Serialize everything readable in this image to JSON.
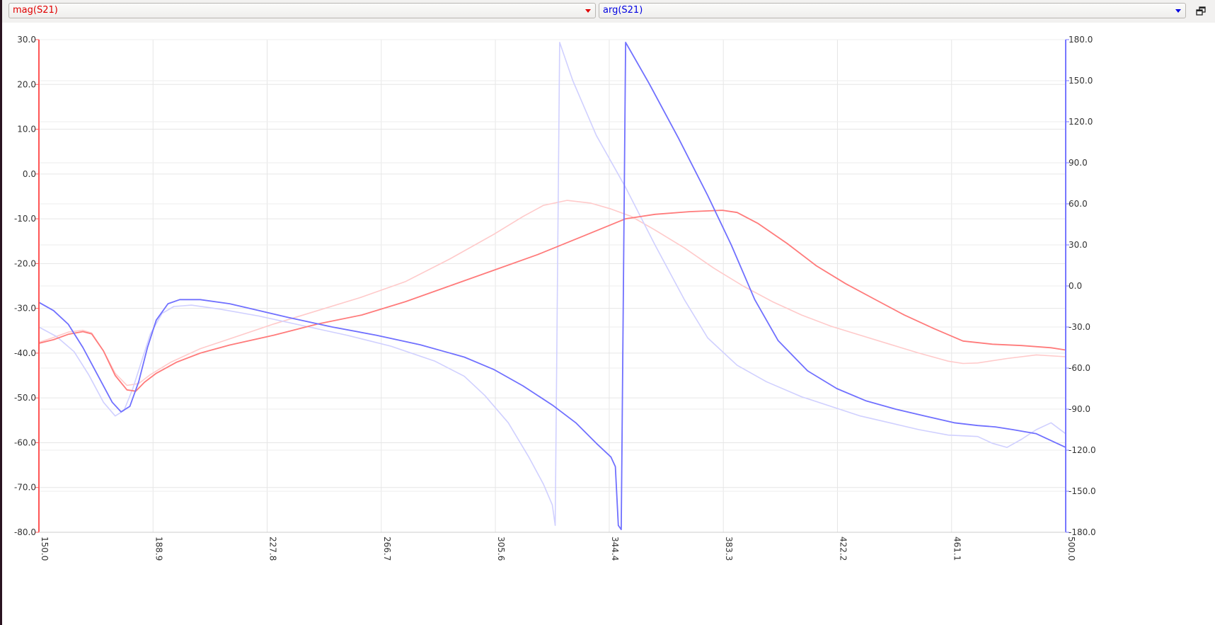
{
  "toolbar": {
    "left_select": {
      "value": "mag(S21)",
      "color": "#e00000"
    },
    "right_select": {
      "value": "arg(S21)",
      "color": "#0000e0"
    },
    "restore_icon": "window-restore-icon"
  },
  "colors": {
    "mag_axis": "#ff5555",
    "arg_axis": "#7777ff",
    "mag_current": "#ff7b7b",
    "mag_previous": "#ffcaca",
    "arg_current": "#7070ff",
    "arg_previous": "#d0d0ff",
    "grid": "#e6e6e6"
  },
  "chart_data": {
    "type": "line",
    "x_axis": {
      "ticks": [
        "150.0",
        "188.9",
        "227.8",
        "266.7",
        "305.6",
        "344.4",
        "383.3",
        "422.2",
        "461.1",
        "500.0"
      ],
      "range": [
        150.0,
        500.0
      ],
      "label_orientation": "vertical"
    },
    "y_left": {
      "ticks": [
        "30.0",
        "20.0",
        "10.0",
        "0.0",
        "-10.0",
        "-20.0",
        "-30.0",
        "-40.0",
        "-50.0",
        "-60.0",
        "-70.0",
        "-80.0"
      ],
      "range": [
        -80,
        30
      ]
    },
    "y_right": {
      "ticks": [
        "180.0",
        "150.0",
        "120.0",
        "90.0",
        "60.0",
        "30.0",
        "0.0",
        "-30.0",
        "-60.0",
        "-90.0",
        "-120.0",
        "-150.0",
        "-180.0"
      ],
      "range": [
        -180,
        180
      ]
    },
    "grid": true,
    "series": [
      {
        "axis": "left",
        "style": "previous",
        "color": "#ffcaca",
        "points": [
          [
            150,
            -37.6
          ],
          [
            155,
            -36.5
          ],
          [
            160,
            -35.3
          ],
          [
            165,
            -34.9
          ],
          [
            168,
            -35.5
          ],
          [
            172,
            -39.5
          ],
          [
            176,
            -44.5
          ],
          [
            180,
            -47.2
          ],
          [
            184,
            -46.8
          ],
          [
            188,
            -44.8
          ],
          [
            195,
            -42
          ],
          [
            205,
            -39
          ],
          [
            215,
            -36.8
          ],
          [
            230,
            -33.5
          ],
          [
            245,
            -30.5
          ],
          [
            260,
            -27.5
          ],
          [
            275,
            -24
          ],
          [
            290,
            -19
          ],
          [
            305,
            -13.5
          ],
          [
            315,
            -9.5
          ],
          [
            322,
            -7
          ],
          [
            330,
            -5.9
          ],
          [
            338,
            -6.5
          ],
          [
            345,
            -7.8
          ],
          [
            352,
            -9.5
          ],
          [
            360,
            -12.5
          ],
          [
            370,
            -16.5
          ],
          [
            380,
            -21
          ],
          [
            390,
            -25
          ],
          [
            400,
            -28.5
          ],
          [
            410,
            -31.5
          ],
          [
            420,
            -34
          ],
          [
            430,
            -36
          ],
          [
            440,
            -38
          ],
          [
            450,
            -40
          ],
          [
            460,
            -41.8
          ],
          [
            465,
            -42.3
          ],
          [
            470,
            -42.2
          ],
          [
            480,
            -41.2
          ],
          [
            490,
            -40.4
          ],
          [
            500,
            -40.8
          ]
        ]
      },
      {
        "axis": "left",
        "style": "current",
        "color": "#ff7b7b",
        "points": [
          [
            150,
            -37.8
          ],
          [
            155,
            -37
          ],
          [
            160,
            -35.8
          ],
          [
            165,
            -35.2
          ],
          [
            168,
            -35.7
          ],
          [
            172,
            -39.5
          ],
          [
            176,
            -45
          ],
          [
            180,
            -48.2
          ],
          [
            183,
            -48.5
          ],
          [
            186,
            -46.5
          ],
          [
            190,
            -44.5
          ],
          [
            197,
            -42
          ],
          [
            205,
            -40
          ],
          [
            215,
            -38.2
          ],
          [
            230,
            -36
          ],
          [
            245,
            -33.5
          ],
          [
            260,
            -31.5
          ],
          [
            275,
            -28.5
          ],
          [
            290,
            -25
          ],
          [
            305,
            -21.5
          ],
          [
            320,
            -18
          ],
          [
            335,
            -14
          ],
          [
            350,
            -10
          ],
          [
            360,
            -9
          ],
          [
            372,
            -8.4
          ],
          [
            383,
            -8.1
          ],
          [
            388,
            -8.6
          ],
          [
            395,
            -11
          ],
          [
            405,
            -15.5
          ],
          [
            415,
            -20.5
          ],
          [
            425,
            -24.5
          ],
          [
            435,
            -28
          ],
          [
            445,
            -31.5
          ],
          [
            455,
            -34.5
          ],
          [
            465,
            -37.3
          ],
          [
            475,
            -38
          ],
          [
            485,
            -38.3
          ],
          [
            495,
            -38.8
          ],
          [
            500,
            -39.3
          ]
        ]
      },
      {
        "axis": "right",
        "style": "previous",
        "color": "#d0d0ff",
        "points": [
          [
            150,
            -30
          ],
          [
            156,
            -37
          ],
          [
            162,
            -48
          ],
          [
            167,
            -65
          ],
          [
            172,
            -85
          ],
          [
            176,
            -95
          ],
          [
            179,
            -91
          ],
          [
            182,
            -75
          ],
          [
            185,
            -55
          ],
          [
            188,
            -35
          ],
          [
            192,
            -20
          ],
          [
            196,
            -15
          ],
          [
            202,
            -14
          ],
          [
            212,
            -17
          ],
          [
            225,
            -22
          ],
          [
            240,
            -29
          ],
          [
            255,
            -36
          ],
          [
            270,
            -44
          ],
          [
            285,
            -55
          ],
          [
            295,
            -66
          ],
          [
            302,
            -80
          ],
          [
            310,
            -100
          ],
          [
            317,
            -125
          ],
          [
            322,
            -145
          ],
          [
            325,
            -160
          ],
          [
            326,
            -175
          ],
          [
            327.5,
            178
          ],
          [
            332,
            150
          ],
          [
            340,
            110
          ],
          [
            350,
            72
          ],
          [
            360,
            30
          ],
          [
            370,
            -10
          ],
          [
            378,
            -38
          ],
          [
            388,
            -58
          ],
          [
            398,
            -70
          ],
          [
            410,
            -81
          ],
          [
            420,
            -88
          ],
          [
            430,
            -95
          ],
          [
            440,
            -100
          ],
          [
            450,
            -105
          ],
          [
            460,
            -109
          ],
          [
            470,
            -110
          ],
          [
            475,
            -115
          ],
          [
            480,
            -118
          ],
          [
            485,
            -112
          ],
          [
            490,
            -105
          ],
          [
            495,
            -100
          ],
          [
            500,
            -108
          ]
        ]
      },
      {
        "axis": "right",
        "style": "current",
        "color": "#7070ff",
        "points": [
          [
            150,
            -12
          ],
          [
            155,
            -18
          ],
          [
            160,
            -28
          ],
          [
            165,
            -45
          ],
          [
            170,
            -65
          ],
          [
            175,
            -85
          ],
          [
            178,
            -92
          ],
          [
            181,
            -88
          ],
          [
            184,
            -70
          ],
          [
            187,
            -45
          ],
          [
            190,
            -25
          ],
          [
            194,
            -13
          ],
          [
            198,
            -10
          ],
          [
            205,
            -10
          ],
          [
            215,
            -13
          ],
          [
            225,
            -18
          ],
          [
            235,
            -23
          ],
          [
            250,
            -30
          ],
          [
            265,
            -36
          ],
          [
            280,
            -43
          ],
          [
            295,
            -52
          ],
          [
            305,
            -61
          ],
          [
            315,
            -73
          ],
          [
            325,
            -87
          ],
          [
            333,
            -100
          ],
          [
            340,
            -115
          ],
          [
            345,
            -125
          ],
          [
            346.5,
            -132
          ],
          [
            347.5,
            -175
          ],
          [
            348.5,
            -178
          ],
          [
            350,
            178
          ],
          [
            358,
            148
          ],
          [
            368,
            108
          ],
          [
            378,
            66
          ],
          [
            386,
            30
          ],
          [
            394,
            -10
          ],
          [
            402,
            -40
          ],
          [
            412,
            -62
          ],
          [
            422,
            -75
          ],
          [
            432,
            -84
          ],
          [
            442,
            -90
          ],
          [
            452,
            -95
          ],
          [
            462,
            -100
          ],
          [
            470,
            -102
          ],
          [
            476,
            -103
          ],
          [
            482,
            -105
          ],
          [
            490,
            -108
          ],
          [
            500,
            -118
          ]
        ]
      }
    ]
  }
}
